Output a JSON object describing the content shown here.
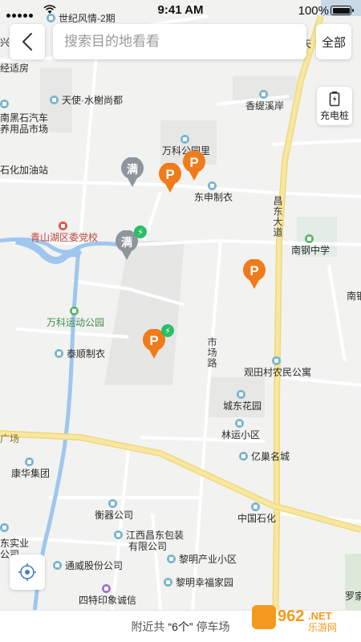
{
  "status_bar": {
    "time": "9:41 AM",
    "battery": "100%"
  },
  "header": {
    "back_icon": "chevron-left-icon",
    "search_placeholder": "搜索目的地看看",
    "all_label": "全部"
  },
  "side": {
    "charging_label": "充电桩",
    "charging_icon": "battery-icon",
    "locate_icon": "crosshair-icon"
  },
  "bottom": {
    "prefix": "附近共",
    "count": "“6个”",
    "suffix": "停车场"
  },
  "pins": [
    {
      "text": "满",
      "type": "full"
    },
    {
      "text": "P",
      "type": "parking"
    },
    {
      "text": "P",
      "type": "parking"
    },
    {
      "text": "满",
      "type": "full",
      "badge": "⚡"
    },
    {
      "text": "P",
      "type": "parking"
    },
    {
      "text": "P",
      "type": "parking",
      "badge": "⚡"
    }
  ],
  "map_labels": {
    "shiji": "世纪风情-2期",
    "xingtian": "兴",
    "jingshi": "经适房",
    "tianshi": "天使·水榭尚都",
    "heishi_1": "南黑石汽车",
    "heishi_2": "养用品市场",
    "xiangti": "香缇溪岸",
    "wanke": "万科公园里",
    "shihua_jiayou": "石化加油站",
    "dongshen": "东申制衣",
    "qingshanhu": "青山湖区委党校",
    "nangang": "南钢中学",
    "wanke_park": "万科运动公园",
    "taishun": "泰顺制衣",
    "guantian": "观田村农民公寓",
    "chengdong": "城东花园",
    "linyun": "林运小区",
    "yichao": "亿巢名城",
    "guang": "广场",
    "kanghua": "康华集团",
    "hengqi": "衡器公司",
    "baozhuang_1": "江西昌东包装",
    "baozhuang_2": "有限公司",
    "zhongguo_shihua": "中国石化",
    "dongshi_1": "东实业",
    "dongshi_2": "公司",
    "tongwei": "通威股份公司",
    "liming_chanye": "黎明产业小区",
    "liming_xingfu": "黎明幸福家园",
    "site_1": "四特印象诚信",
    "site_2": "购物中心",
    "nangang_right": "南钢",
    "luo": "罗家",
    "tian_right": "天",
    "changdong_road": "昌东大道",
    "shichang_road": "市场路"
  },
  "watermark": {
    "number": "962",
    "suffix": ".NET",
    "text": "乐游网"
  }
}
